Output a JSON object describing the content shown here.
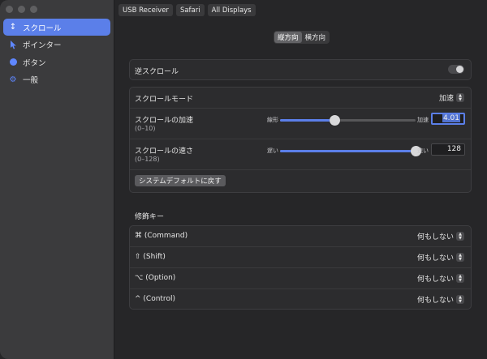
{
  "sidebar": {
    "items": [
      {
        "label": "スクロール",
        "icon": "scroll-arrows-icon",
        "active": true
      },
      {
        "label": "ポインター",
        "icon": "pointer-cursor-icon",
        "active": false
      },
      {
        "label": "ボタン",
        "icon": "button-dot-icon",
        "active": false
      },
      {
        "label": "一般",
        "icon": "gear-icon",
        "active": false
      }
    ]
  },
  "device_tabs": [
    "USB Receiver",
    "Safari",
    "All Displays"
  ],
  "orientation": {
    "options": [
      "縦方向",
      "横方向"
    ],
    "selected": "縦方向"
  },
  "reverse_scroll": {
    "label": "逆スクロール",
    "enabled": false
  },
  "scroll_panel": {
    "mode": {
      "label": "スクロールモード",
      "value": "加速"
    },
    "acceleration": {
      "label": "スクロールの加速",
      "range": "(0–10)",
      "min_label": "線形",
      "max_label": "加速",
      "value": "4.01",
      "fraction": 0.401
    },
    "speed": {
      "label": "スクロールの速さ",
      "range": "(0–128)",
      "min_label": "遅い",
      "max_label": "速い",
      "value": "128",
      "fraction": 1.0
    },
    "reset_button": "システムデフォルトに戻す"
  },
  "modifier_section": {
    "title": "修飾キー",
    "rows": [
      {
        "key": "⌘ (Command)",
        "value": "何もしない"
      },
      {
        "key": "⇧ (Shift)",
        "value": "何もしない"
      },
      {
        "key": "⌥ (Option)",
        "value": "何もしない"
      },
      {
        "key": "^ (Control)",
        "value": "何もしない"
      }
    ]
  },
  "colors": {
    "accent": "#5b7fe9",
    "sidebar_bg": "#3b3b3d",
    "content_bg": "#262628"
  }
}
